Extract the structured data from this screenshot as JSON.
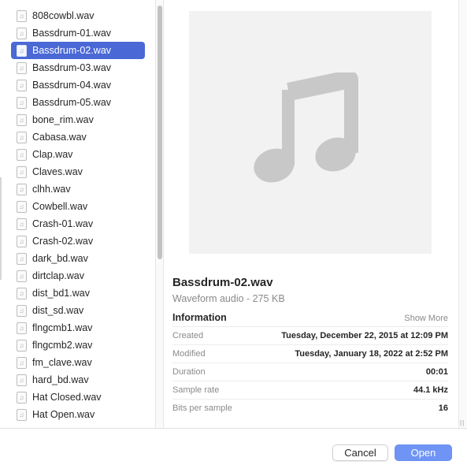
{
  "files": [
    {
      "name": "808cowbl.wav",
      "selected": false
    },
    {
      "name": "Bassdrum-01.wav",
      "selected": false
    },
    {
      "name": "Bassdrum-02.wav",
      "selected": true
    },
    {
      "name": "Bassdrum-03.wav",
      "selected": false
    },
    {
      "name": "Bassdrum-04.wav",
      "selected": false
    },
    {
      "name": "Bassdrum-05.wav",
      "selected": false
    },
    {
      "name": "bone_rim.wav",
      "selected": false
    },
    {
      "name": "Cabasa.wav",
      "selected": false
    },
    {
      "name": "Clap.wav",
      "selected": false
    },
    {
      "name": "Claves.wav",
      "selected": false
    },
    {
      "name": "clhh.wav",
      "selected": false
    },
    {
      "name": "Cowbell.wav",
      "selected": false
    },
    {
      "name": "Crash-01.wav",
      "selected": false
    },
    {
      "name": "Crash-02.wav",
      "selected": false
    },
    {
      "name": "dark_bd.wav",
      "selected": false
    },
    {
      "name": "dirtclap.wav",
      "selected": false
    },
    {
      "name": "dist_bd1.wav",
      "selected": false
    },
    {
      "name": "dist_sd.wav",
      "selected": false
    },
    {
      "name": "flngcmb1.wav",
      "selected": false
    },
    {
      "name": "flngcmb2.wav",
      "selected": false
    },
    {
      "name": "fm_clave.wav",
      "selected": false
    },
    {
      "name": "hard_bd.wav",
      "selected": false
    },
    {
      "name": "Hat Closed.wav",
      "selected": false
    },
    {
      "name": "Hat Open.wav",
      "selected": false
    }
  ],
  "file_icon": "audio-file-icon",
  "preview": {
    "icon": "music-note-icon",
    "file_name": "Bassdrum-02.wav",
    "file_kind": "Waveform audio - 275 KB",
    "info_title": "Information",
    "show_more": "Show More",
    "info": [
      {
        "label": "Created",
        "value": "Tuesday, December 22, 2015 at 12:09 PM"
      },
      {
        "label": "Modified",
        "value": "Tuesday, January 18, 2022 at 2:52 PM"
      },
      {
        "label": "Duration",
        "value": "00:01"
      },
      {
        "label": "Sample rate",
        "value": "44.1 kHz"
      },
      {
        "label": "Bits per sample",
        "value": "16"
      }
    ]
  },
  "footer": {
    "cancel_label": "Cancel",
    "open_label": "Open"
  },
  "colors": {
    "selection": "#4a69d6",
    "primary_button": "#6f94f5"
  }
}
